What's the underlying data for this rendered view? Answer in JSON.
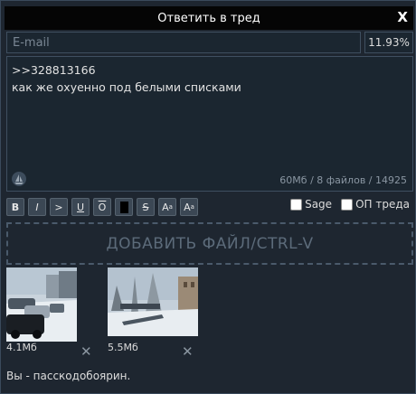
{
  "dialog": {
    "title": "Ответить в тред",
    "close_label": "X"
  },
  "email": {
    "placeholder": "E-mail",
    "value": ""
  },
  "progress_text": "11.93%",
  "message": {
    "text": ">>328813166\nкак же охуенно под белыми списками"
  },
  "limits_text": "60Мб / 8 файлов / 14925",
  "toolbar": {
    "buttons": [
      {
        "label": "B",
        "name": "bold"
      },
      {
        "label": "I",
        "name": "italic"
      },
      {
        "label": ">",
        "name": "quote"
      },
      {
        "label": "U",
        "name": "underline"
      },
      {
        "label": "O",
        "name": "overline"
      },
      {
        "label": "",
        "name": "spoiler"
      },
      {
        "label": "S",
        "name": "strike"
      },
      {
        "label": "A",
        "name": "superscript"
      },
      {
        "label": "A",
        "name": "subscript"
      }
    ],
    "sup_mark": "a",
    "sub_mark": "a"
  },
  "options": {
    "sage_label": "Sage",
    "op_label": "ОП треда"
  },
  "dropzone_label": "ДОБАВИТЬ ФАЙЛ/CTRL-V",
  "files": [
    {
      "size": "4.1Мб",
      "remove_label": "✕"
    },
    {
      "size": "5.5Мб",
      "remove_label": "✕"
    }
  ],
  "status_text": "Вы - пасскодобоярин."
}
